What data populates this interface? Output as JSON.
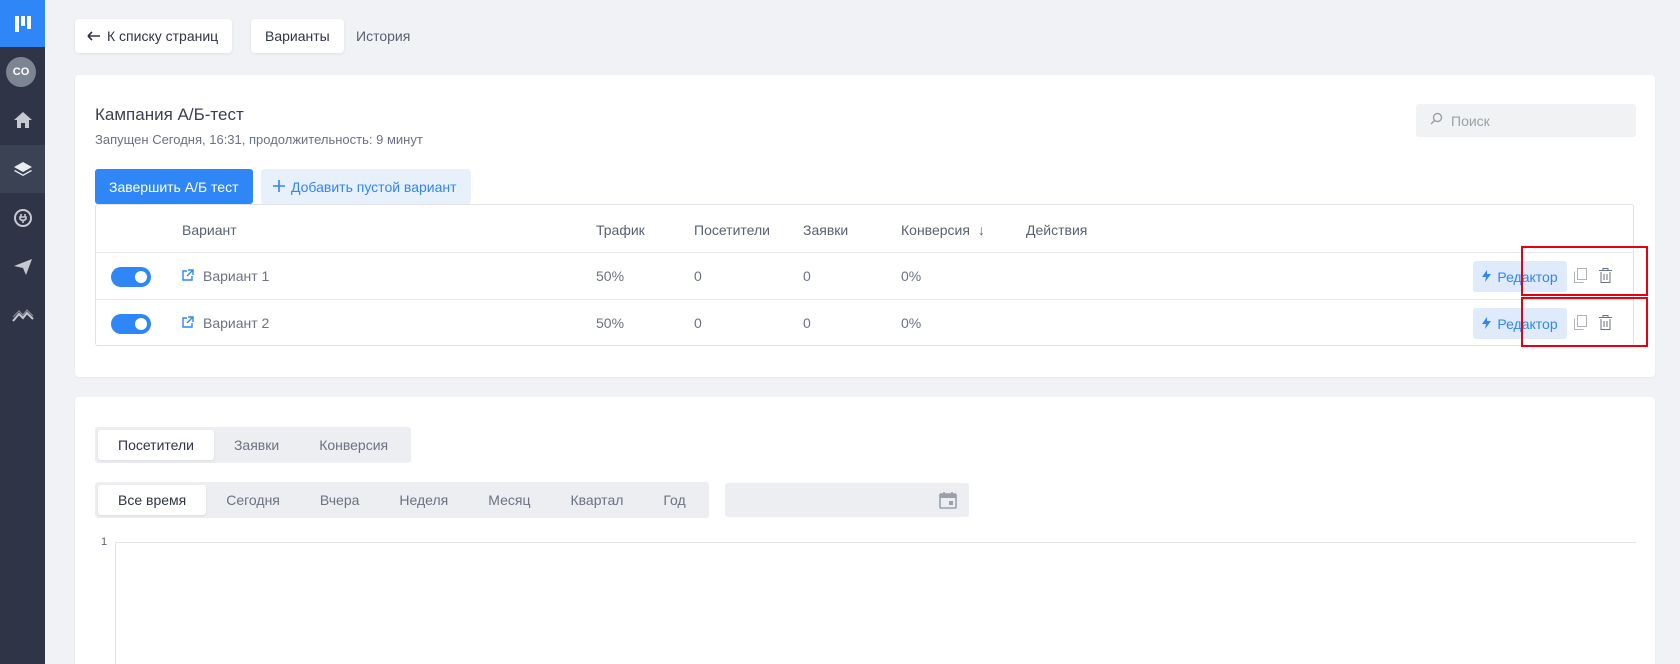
{
  "nav": {
    "back_label": "К списку страниц",
    "tabs": [
      {
        "label": "Варианты",
        "active": true
      },
      {
        "label": "История",
        "active": false
      }
    ]
  },
  "sidebar": {
    "avatar": "CO",
    "icons": [
      "logo-icon",
      "home-icon",
      "layers-icon",
      "plug-icon",
      "send-icon",
      "analytics-icon"
    ],
    "active_item": "layers-icon"
  },
  "campaign": {
    "title": "Кампания А/Б-тест",
    "subtitle": "Запущен Сегодня, 16:31, продолжительность: 9 минут",
    "search_placeholder": "Поиск",
    "finish_button": "Завершить А/Б тест",
    "add_button": "Добавить пустой вариант"
  },
  "table": {
    "headers": {
      "variant": "Вариант",
      "traffic": "Трафик",
      "visitors": "Посетители",
      "leads": "Заявки",
      "conversion": "Конверсия",
      "actions": "Действия"
    },
    "sort_indicator": "↓",
    "rows": [
      {
        "name": "Вариант 1",
        "traffic": "50%",
        "visitors": "0",
        "leads": "0",
        "conversion": "0%",
        "enabled": true,
        "editor_label": "Редактор"
      },
      {
        "name": "Вариант 2",
        "traffic": "50%",
        "visitors": "0",
        "leads": "0",
        "conversion": "0%",
        "enabled": true,
        "editor_label": "Редактор"
      }
    ]
  },
  "stats": {
    "metric_tabs": [
      {
        "label": "Посетители",
        "active": true
      },
      {
        "label": "Заявки",
        "active": false
      },
      {
        "label": "Конверсия",
        "active": false
      }
    ],
    "period_tabs": [
      {
        "label": "Все время",
        "active": true
      },
      {
        "label": "Сегодня",
        "active": false
      },
      {
        "label": "Вчера",
        "active": false
      },
      {
        "label": "Неделя",
        "active": false
      },
      {
        "label": "Месяц",
        "active": false
      },
      {
        "label": "Квартал",
        "active": false
      },
      {
        "label": "Год",
        "active": false
      }
    ],
    "y_tick_top": "1"
  },
  "colors": {
    "accent": "#2f86f6",
    "sidebar": "#2f3546",
    "highlight": "#e60012"
  }
}
